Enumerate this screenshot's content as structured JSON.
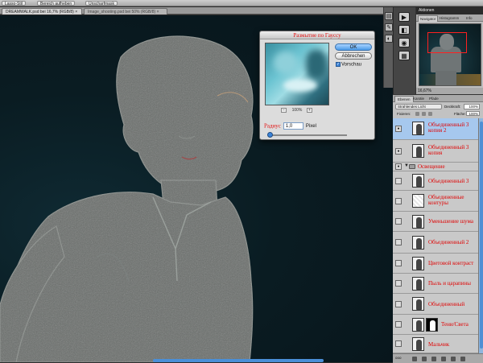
{
  "options_bar": {
    "buttons": [
      "Lasso-Stil",
      "Bereich aufheben",
      "Unscharfmask"
    ]
  },
  "document_tabs": [
    {
      "label": "DREAMWALK.psd bei 16,7% (RGB/8) ×",
      "active": true
    },
    {
      "label": "Image_shooting.psd bei 50% (RGB/8) ×",
      "active": false
    }
  ],
  "blur_dialog": {
    "title": "Размытие по Гауссу",
    "ok_label": "OK",
    "cancel_label": "Abbrechen",
    "preview_label": "Vorschau",
    "preview_checked": true,
    "zoom_minus": "−",
    "zoom_plus": "+",
    "zoom_value": "100%",
    "radius_label": "Радиус",
    "radius_value": "1,0",
    "radius_unit": "Pixel"
  },
  "navigator": {
    "header": "Aktionen",
    "tabs": [
      "Navigator",
      "Histogramm",
      "Info"
    ],
    "zoom_footer": "16,67%"
  },
  "layers_panel": {
    "tabs": [
      "Ebenen",
      "Kanäle",
      "Pfade"
    ],
    "blend_mode": "Strahlendes Licht",
    "opacity_label": "Deckkraft:",
    "opacity_value": "100%",
    "lock_label": "Fixieren:",
    "fill_label": "Fläche:",
    "fill_value": "100%",
    "layers": [
      {
        "name": "Объединенный 3 копия 2",
        "selected": true,
        "kind": "pixel"
      },
      {
        "name": "Объединенный 3 копия",
        "selected": false,
        "kind": "pixel"
      },
      {
        "name": "Освещение",
        "selected": false,
        "kind": "group"
      },
      {
        "name": "Объединенный 3",
        "selected": false,
        "kind": "pixel"
      },
      {
        "name": "Объединенные контуры",
        "selected": false,
        "kind": "empty"
      },
      {
        "name": "Уменьшение шума",
        "selected": false,
        "kind": "pixel"
      },
      {
        "name": "Объединенный 2",
        "selected": false,
        "kind": "pixel"
      },
      {
        "name": "Цветовой контраст",
        "selected": false,
        "kind": "pixel"
      },
      {
        "name": "Пыль и царапины",
        "selected": false,
        "kind": "pixel"
      },
      {
        "name": "Объединенный",
        "selected": false,
        "kind": "pixel"
      },
      {
        "name": "Тени/Света",
        "selected": false,
        "kind": "masked"
      },
      {
        "name": "Мальчик",
        "selected": false,
        "kind": "pixel"
      }
    ],
    "footer_link": "ooo"
  },
  "colors": {
    "annotation_red": "#e00000",
    "selection_blue": "#a6c8ee",
    "accent_blue": "#4c9be8"
  }
}
